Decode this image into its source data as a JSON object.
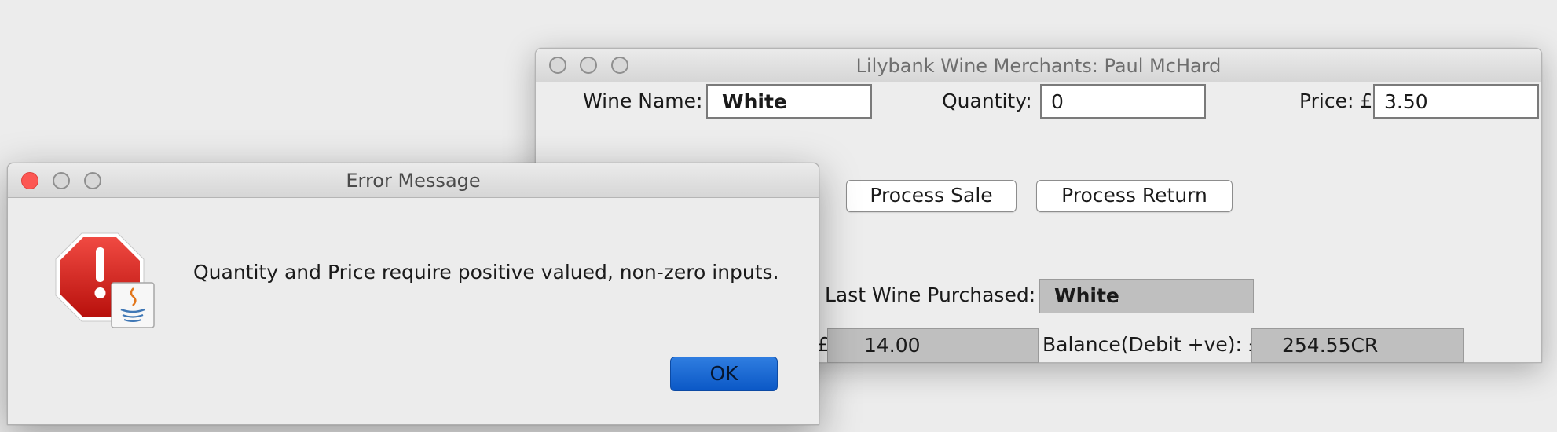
{
  "main_window": {
    "title": "Lilybank Wine Merchants: Paul McHard",
    "wine_name_label": "Wine Name:",
    "wine_name_value": "White",
    "quantity_label": "Quantity:",
    "quantity_value": "0",
    "price_label": "Price: £",
    "price_value": "3.50",
    "process_sale_label": "Process Sale",
    "process_return_label": "Process Return",
    "last_wine_label": "Last Wine Purchased:",
    "last_wine_value": "White",
    "amount_currency": "£",
    "amount_value": "14.00",
    "balance_label": "Balance(Debit +ve): £",
    "balance_value": "254.55CR"
  },
  "dialog": {
    "title": "Error Message",
    "message": "Quantity and Price require positive valued, non-zero inputs.",
    "ok_label": "OK"
  },
  "colors": {
    "ok_button": "#1560d0",
    "close_light": "#fc5753",
    "readonly_field": "#bfbfbf"
  },
  "icons": [
    "error-stop-icon",
    "java-badge-icon"
  ]
}
